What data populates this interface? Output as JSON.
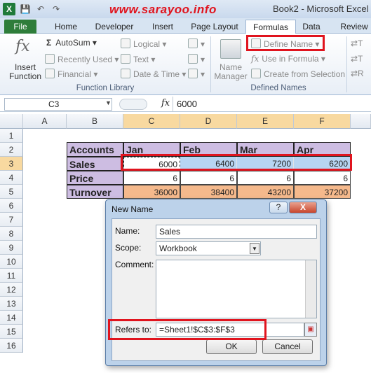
{
  "window": {
    "title": "Book2 - Microsoft Excel",
    "watermark": "www.sarayoo.info"
  },
  "qat": {
    "save_icon": "save-icon",
    "undo_icon": "undo-icon",
    "redo_icon": "redo-icon"
  },
  "tabs": [
    "File",
    "Home",
    "Developer",
    "Insert",
    "Page Layout",
    "Formulas",
    "Data",
    "Review"
  ],
  "ribbon": {
    "insert_function": "Insert Function",
    "autosum": "AutoSum",
    "recently_used": "Recently Used",
    "financial": "Financial",
    "logical": "Logical",
    "text": "Text",
    "date_time": "Date & Time",
    "name_manager": "Name Manager",
    "define_name": "Define Name",
    "use_in_formula": "Use in Formula",
    "create_from_selection": "Create from Selection",
    "group_function_library": "Function Library",
    "group_defined_names": "Defined Names"
  },
  "formula_bar": {
    "name_box": "C3",
    "fx": "fx",
    "content": "6000"
  },
  "grid": {
    "columns": [
      "A",
      "B",
      "C",
      "D",
      "E",
      "F"
    ],
    "rows": [
      "1",
      "2",
      "3",
      "4",
      "5",
      "6",
      "7",
      "8",
      "9",
      "10",
      "11",
      "12",
      "13",
      "14",
      "15",
      "16"
    ],
    "header_row": [
      "Accounts",
      "Jan",
      "Feb",
      "Mar",
      "Apr"
    ],
    "sales": [
      "Sales",
      "6000",
      "6400",
      "7200",
      "6200"
    ],
    "price": [
      "Price",
      "6",
      "6",
      "6",
      "6"
    ],
    "turnover": [
      "Turnover",
      "36000",
      "38400",
      "43200",
      "37200"
    ]
  },
  "dialog": {
    "title": "New Name",
    "help": "?",
    "close": "X",
    "name_label": "Name:",
    "name_value": "Sales",
    "scope_label": "Scope:",
    "scope_value": "Workbook",
    "comment_label": "Comment:",
    "refers_label": "Refers to:",
    "refers_value": "=Sheet1!$C$3:$F$3",
    "ok": "OK",
    "cancel": "Cancel"
  },
  "colors": {
    "accent_red": "#e0141e",
    "selection": "#b7d5f2",
    "turnover": "#f5b98c",
    "label": "#cdbde2"
  }
}
